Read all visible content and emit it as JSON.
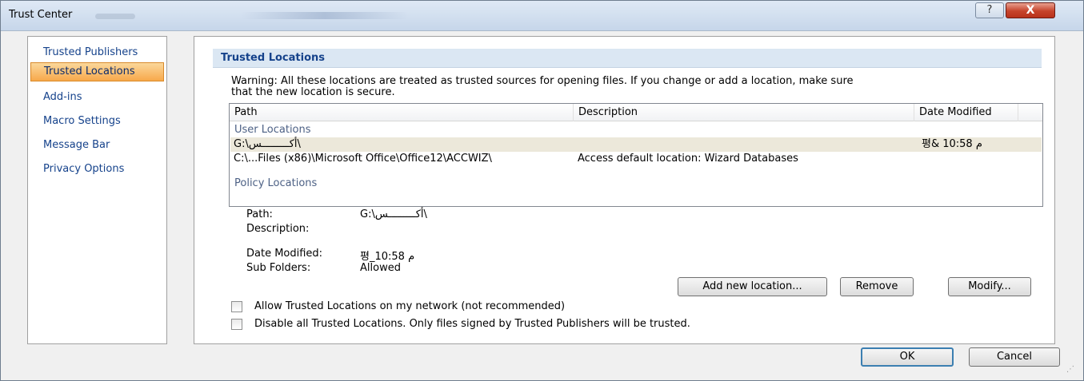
{
  "window": {
    "title": "Trust Center",
    "help_glyph": "?",
    "close_glyph": "X"
  },
  "nav": {
    "items": [
      {
        "label": "Trusted Publishers"
      },
      {
        "label": "Trusted Locations"
      },
      {
        "label": "Add-ins"
      },
      {
        "label": "Macro Settings"
      },
      {
        "label": "Message Bar"
      },
      {
        "label": "Privacy Options"
      }
    ],
    "selected": "Trusted Locations"
  },
  "main": {
    "section_title": "Trusted Locations",
    "warning_line1": "Warning: All these locations are treated as trusted sources for opening files.  If you change or add a location, make sure",
    "warning_line2": "that the new location is secure.",
    "list": {
      "columns": [
        "Path",
        "Description",
        "Date Modified"
      ],
      "group_user": "User Locations",
      "group_policy": "Policy Locations",
      "rows": [
        {
          "path": "G:\\أكـــــــــس\\",
          "description": "",
          "date": "평& 10:58 م"
        },
        {
          "path": "C:\\...Files (x86)\\Microsoft Office\\Office12\\ACCWIZ\\",
          "description": "Access default location: Wizard Databases",
          "date": ""
        }
      ]
    },
    "details": {
      "path_label": "Path:",
      "path_value": "G:\\أكـــــــــس\\",
      "description_label": "Description:",
      "date_label": "Date Modified:",
      "date_value": "평_10:58 م",
      "subfolders_label": "Sub Folders:",
      "subfolders_value": "Allowed"
    },
    "buttons": {
      "add": "Add new location...",
      "remove": "Remove",
      "modify": "Modify..."
    },
    "checkboxes": {
      "allow_network": "Allow Trusted Locations on my network (not recommended)",
      "disable_all": "Disable all Trusted Locations. Only files signed by Trusted Publishers will be trusted."
    }
  },
  "footer": {
    "ok": "OK",
    "cancel": "Cancel"
  }
}
